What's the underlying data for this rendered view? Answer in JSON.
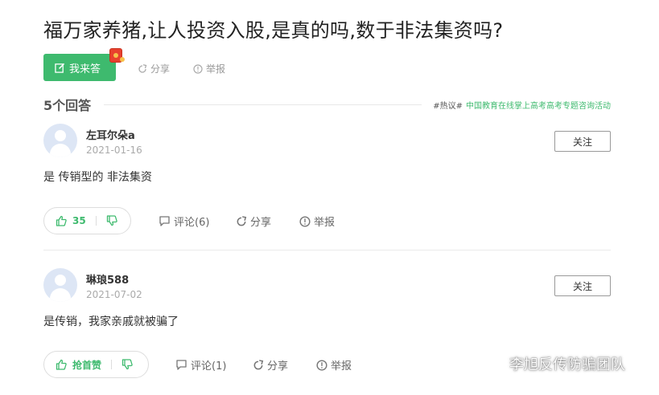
{
  "question": {
    "title": "福万家养猪,让人投资入股,是真的吗,数于非法集资吗?"
  },
  "toolbar": {
    "answer_label": "我来答",
    "share_label": "分享",
    "report_label": "举报"
  },
  "answers_header": {
    "count_label": "5个回答",
    "hot_tag": "#热议#",
    "hot_topic": "中国教育在线掌上高考高考专题咨询活动"
  },
  "answers": [
    {
      "username": "左耳尔朵a",
      "date": "2021-01-16",
      "follow_label": "关注",
      "text": "是 传销型的 非法集资",
      "like_label": "35",
      "comment_label": "评论(6)",
      "share_label": "分享",
      "report_label": "举报"
    },
    {
      "username": "琳琅588",
      "date": "2021-07-02",
      "follow_label": "关注",
      "text": "是传销，我家亲戚就被骗了",
      "like_label": "抢首赞",
      "comment_label": "评论(1)",
      "share_label": "分享",
      "report_label": "举报"
    }
  ],
  "watermark": {
    "text": "李旭反传防骗团队"
  },
  "colors": {
    "accent": "#3eba6e",
    "redpacket": "#e8402e"
  }
}
